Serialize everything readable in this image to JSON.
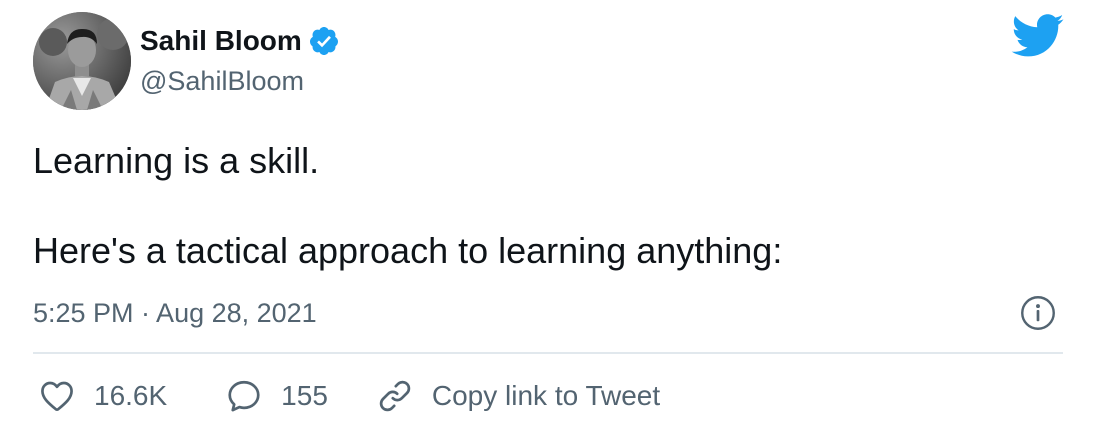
{
  "author": {
    "name": "Sahil Bloom",
    "handle": "@SahilBloom",
    "verified": true
  },
  "tweet": {
    "paragraphs": [
      "Learning is a skill.",
      "Here's a tactical approach to learning anything:"
    ],
    "timestamp": "5:25 PM · Aug 28, 2021"
  },
  "actions": {
    "likes": "16.6K",
    "replies": "155",
    "copy_link_label": "Copy link to Tweet"
  },
  "icons": {
    "brand": "twitter-bird-icon",
    "verified": "verified-badge-icon",
    "info": "info-icon",
    "like": "heart-icon",
    "reply": "reply-bubble-icon",
    "link": "link-icon"
  },
  "colors": {
    "brand_blue": "#1da1f2",
    "text": "#0f1419",
    "secondary_text": "#536471",
    "divider": "#e1e8ed"
  }
}
